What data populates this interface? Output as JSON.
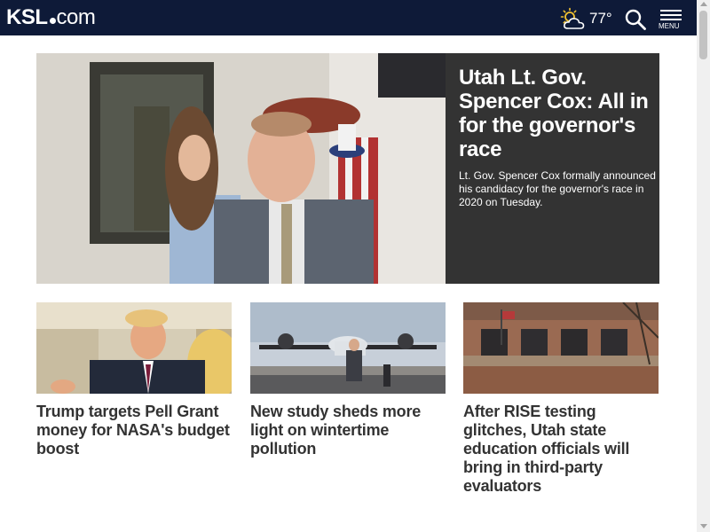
{
  "header": {
    "logo_main": "KSL",
    "logo_suffix": "com",
    "weather_icon": "partly-cloudy-icon",
    "temperature": "77°",
    "search_icon": "search-icon",
    "menu_label": "MENU"
  },
  "hero": {
    "title": "Utah Lt. Gov. Spencer Cox: All in for the governor's race",
    "description": "Lt. Gov. Spencer Cox formally announced his candidacy for the governor's race in 2020 on Tuesday."
  },
  "stories": [
    {
      "title": "Trump targets Pell Grant money for NASA's budget boost"
    },
    {
      "title": "New study sheds more light on wintertime pollution"
    },
    {
      "title": "After RISE testing glitches, Utah state education officials will bring in third-party evaluators"
    }
  ],
  "colors": {
    "header_bg": "#0e1a38",
    "hero_panel_bg": "#333333",
    "headline_text": "#333333"
  }
}
